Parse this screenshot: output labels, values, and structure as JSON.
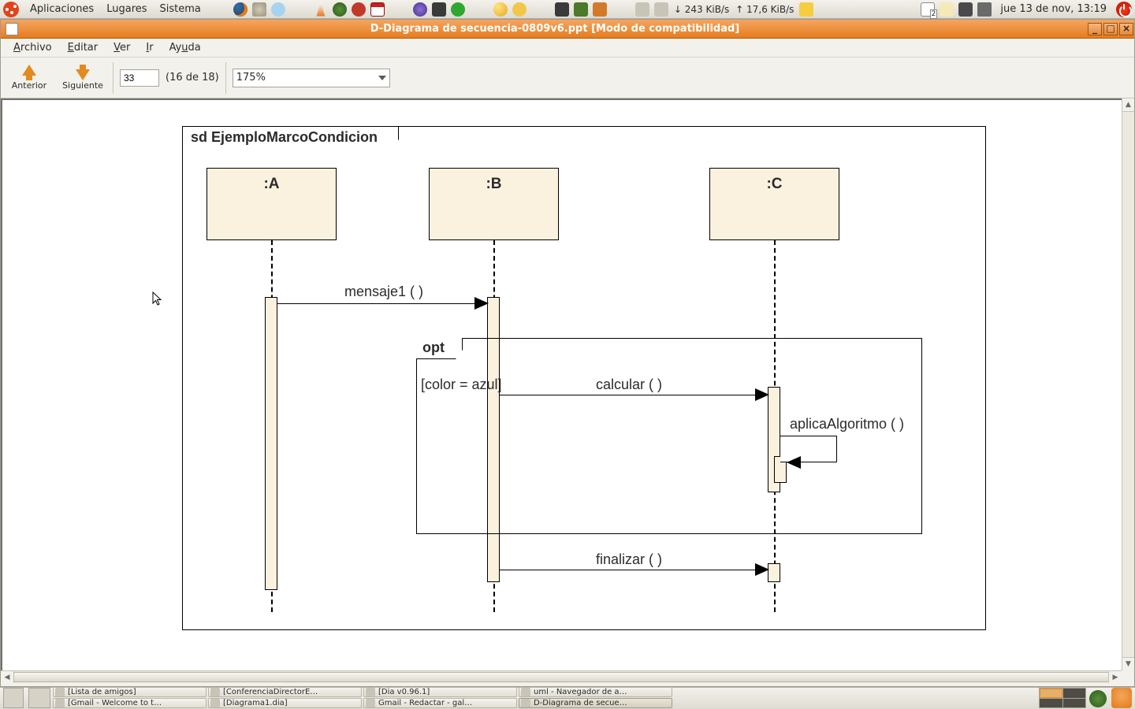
{
  "panel": {
    "menus": [
      "Aplicaciones",
      "Lugares",
      "Sistema"
    ],
    "net_down": "↓ 243 KiB/s",
    "net_up": "↑ 17,6 KiB/s",
    "mail_badge": "2",
    "clock": "jue 13 de nov, 13:19"
  },
  "window": {
    "title": "D-Diagrama de secuencia-0809v6.ppt [Modo de compatibilidad]"
  },
  "menubar": {
    "archivo": "Archivo",
    "editar": "Editar",
    "ver": "Ver",
    "ir": "Ir",
    "ayuda": "Ayuda"
  },
  "toolbar": {
    "prev": "Anterior",
    "next": "Siguiente",
    "page_value": "33",
    "page_counter": "(16 de 18)",
    "zoom": "175%"
  },
  "diagram": {
    "frame_label": "sd  EjemploMarcoCondicion",
    "lifelines": {
      "a": ":A",
      "b": ":B",
      "c": ":C"
    },
    "msg1": "mensaje1 ( )",
    "opt_label": "opt",
    "opt_guard": "[color = azul]",
    "msg_calc": "calcular ( )",
    "msg_algo": "aplicaAlgoritmo ( )",
    "msg_fin": "finalizar ( )"
  },
  "taskbar": {
    "t0": "[Lista de amigos]",
    "t1": "[ConferenciaDirectorE…",
    "t2": "[Dia v0.96.1]",
    "t3": "uml - Navegador de a…",
    "t4": "[Gmail - Welcome to t…",
    "t5": "[Diagrama1.dia]",
    "t6": "Gmail - Redactar - gal…",
    "t7": "D-Diagrama de secue…"
  }
}
